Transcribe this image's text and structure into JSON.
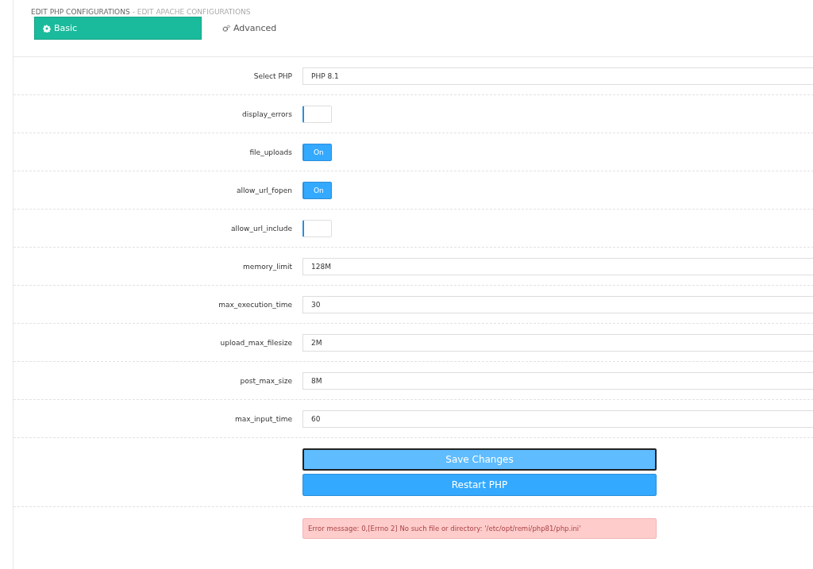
{
  "breadcrumb": {
    "current": "EDIT PHP CONFIGURATIONS",
    "other": "- EDIT APACHE CONFIGURATIONS"
  },
  "tabs": [
    {
      "label": "Basic",
      "kind": "basic",
      "selected": true
    },
    {
      "label": "Advanced",
      "kind": "advanced",
      "selected": false
    }
  ],
  "settings": [
    {
      "label": "Select PHP",
      "kind": "select",
      "value": "PHP 8.1"
    },
    {
      "label": "display_errors",
      "kind": "toggle",
      "on": false
    },
    {
      "label": "file_uploads",
      "kind": "toggle",
      "on": true,
      "on_text": "On"
    },
    {
      "label": "allow_url_fopen",
      "kind": "toggle",
      "on": true,
      "on_text": "On"
    },
    {
      "label": "allow_url_include",
      "kind": "toggle",
      "on": false
    },
    {
      "label": "memory_limit",
      "kind": "text",
      "value": "128M"
    },
    {
      "label": "max_execution_time",
      "kind": "text",
      "value": "30"
    },
    {
      "label": "upload_max_filesize",
      "kind": "text",
      "value": "2M"
    },
    {
      "label": "post_max_size",
      "kind": "text",
      "value": "8M"
    },
    {
      "label": "max_input_time",
      "kind": "text",
      "value": "60"
    }
  ],
  "buttons": [
    {
      "label": "Save Changes",
      "focused": true
    },
    {
      "label": "Restart PHP",
      "focused": false
    }
  ],
  "error_message": "Error message: 0,[Errno 2] No such file or directory: '/etc/opt/remi/php81/php.ini'"
}
